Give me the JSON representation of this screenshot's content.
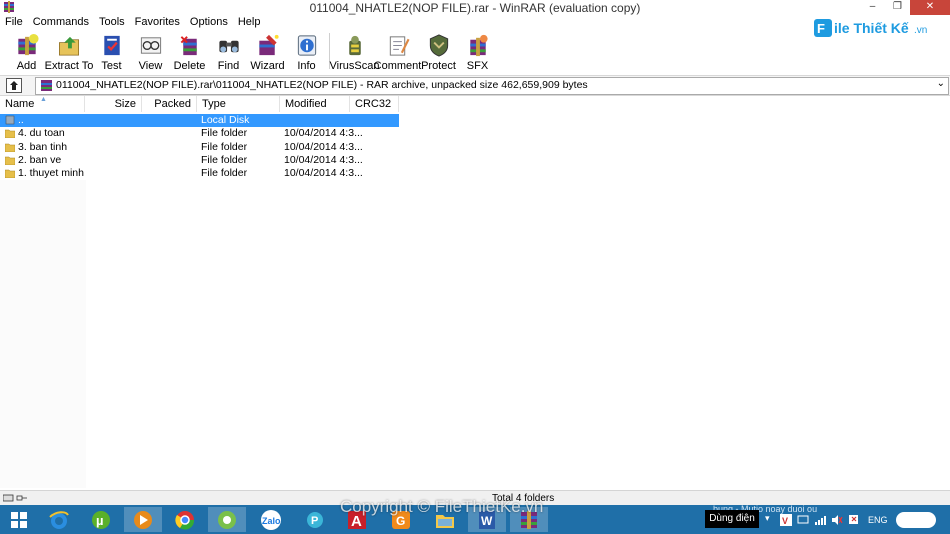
{
  "window": {
    "title": "011004_NHATLE2(NOP FILE).rar - WinRAR (evaluation copy)"
  },
  "menu": [
    "File",
    "Commands",
    "Tools",
    "Favorites",
    "Options",
    "Help"
  ],
  "watermark": {
    "logo_text": "File Thiết Kế.vn",
    "copyright": "Copyright © FileThietKe.vn"
  },
  "toolbar": [
    {
      "label": "Add",
      "icon": "add-icon"
    },
    {
      "label": "Extract To",
      "icon": "extract-to-icon"
    },
    {
      "label": "Test",
      "icon": "test-icon"
    },
    {
      "label": "View",
      "icon": "view-icon"
    },
    {
      "label": "Delete",
      "icon": "delete-icon"
    },
    {
      "label": "Find",
      "icon": "find-icon"
    },
    {
      "label": "Wizard",
      "icon": "wizard-icon"
    },
    {
      "label": "Info",
      "icon": "info-icon"
    },
    {
      "label": "VirusScan",
      "icon": "virusscan-icon"
    },
    {
      "label": "Comment",
      "icon": "comment-icon"
    },
    {
      "label": "Protect",
      "icon": "protect-icon"
    },
    {
      "label": "SFX",
      "icon": "sfx-icon"
    }
  ],
  "address": {
    "path": "011004_NHATLE2(NOP FILE).rar\\011004_NHATLE2(NOP FILE) - RAR archive, unpacked size 462,659,909 bytes"
  },
  "columns": [
    "Name",
    "Size",
    "Packed",
    "Type",
    "Modified",
    "CRC32"
  ],
  "files": [
    {
      "name": "..",
      "size": "",
      "packed": "",
      "type": "Local Disk",
      "modified": "",
      "crc": "",
      "selected": true
    },
    {
      "name": "4. du toan",
      "size": "",
      "packed": "",
      "type": "File folder",
      "modified": "10/04/2014 4:3...",
      "crc": ""
    },
    {
      "name": "3. ban tinh",
      "size": "",
      "packed": "",
      "type": "File folder",
      "modified": "10/04/2014 4:3...",
      "crc": ""
    },
    {
      "name": "2. ban ve",
      "size": "",
      "packed": "",
      "type": "File folder",
      "modified": "10/04/2014 4:3...",
      "crc": ""
    },
    {
      "name": "1. thuyet minh",
      "size": "",
      "packed": "",
      "type": "File folder",
      "modified": "10/04/2014 4:3...",
      "crc": ""
    }
  ],
  "status": {
    "text": "Total 4 folders"
  },
  "taskbar": {
    "tray_box": "Dùng điện",
    "language": "ENG",
    "notice": "bung - Mutio noay duoi ou"
  }
}
